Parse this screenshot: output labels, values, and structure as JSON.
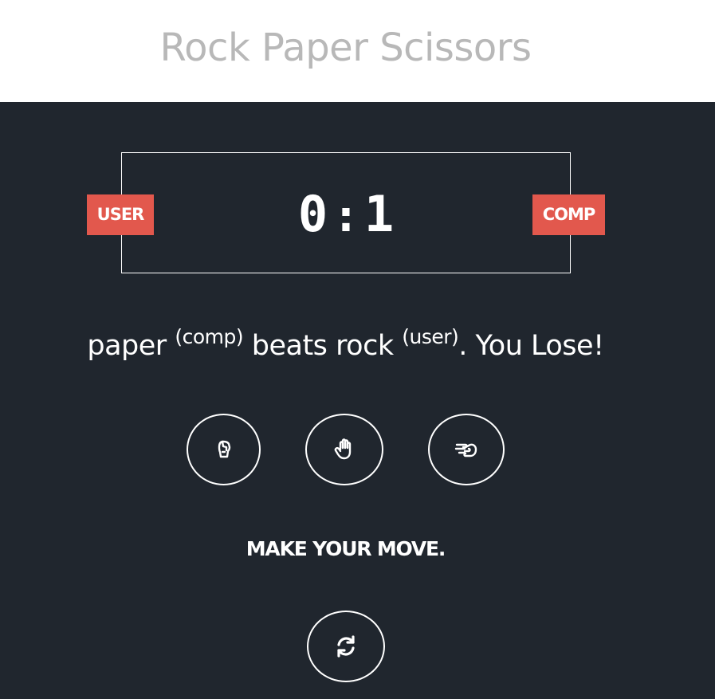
{
  "header": {
    "title": "Rock Paper Scissors"
  },
  "scoreboard": {
    "user_label": "USER",
    "comp_label": "COMP",
    "user_score": "0",
    "separator": ":",
    "comp_score": "1"
  },
  "result": {
    "comp_choice": "paper",
    "comp_tag": "(comp)",
    "verb": "beats",
    "user_choice": "rock",
    "user_tag": "(user)",
    "outcome": ". You Lose!"
  },
  "choices": [
    {
      "name": "rock",
      "icon": "hand-rock-icon"
    },
    {
      "name": "paper",
      "icon": "hand-paper-icon"
    },
    {
      "name": "scissors",
      "icon": "hand-scissors-icon"
    }
  ],
  "prompt": "MAKE YOUR MOVE.",
  "reset": {
    "icon": "refresh-icon"
  },
  "colors": {
    "background": "#20262e",
    "badge": "#e2584d",
    "title": "#b8b8b8",
    "foreground": "#ffffff"
  }
}
